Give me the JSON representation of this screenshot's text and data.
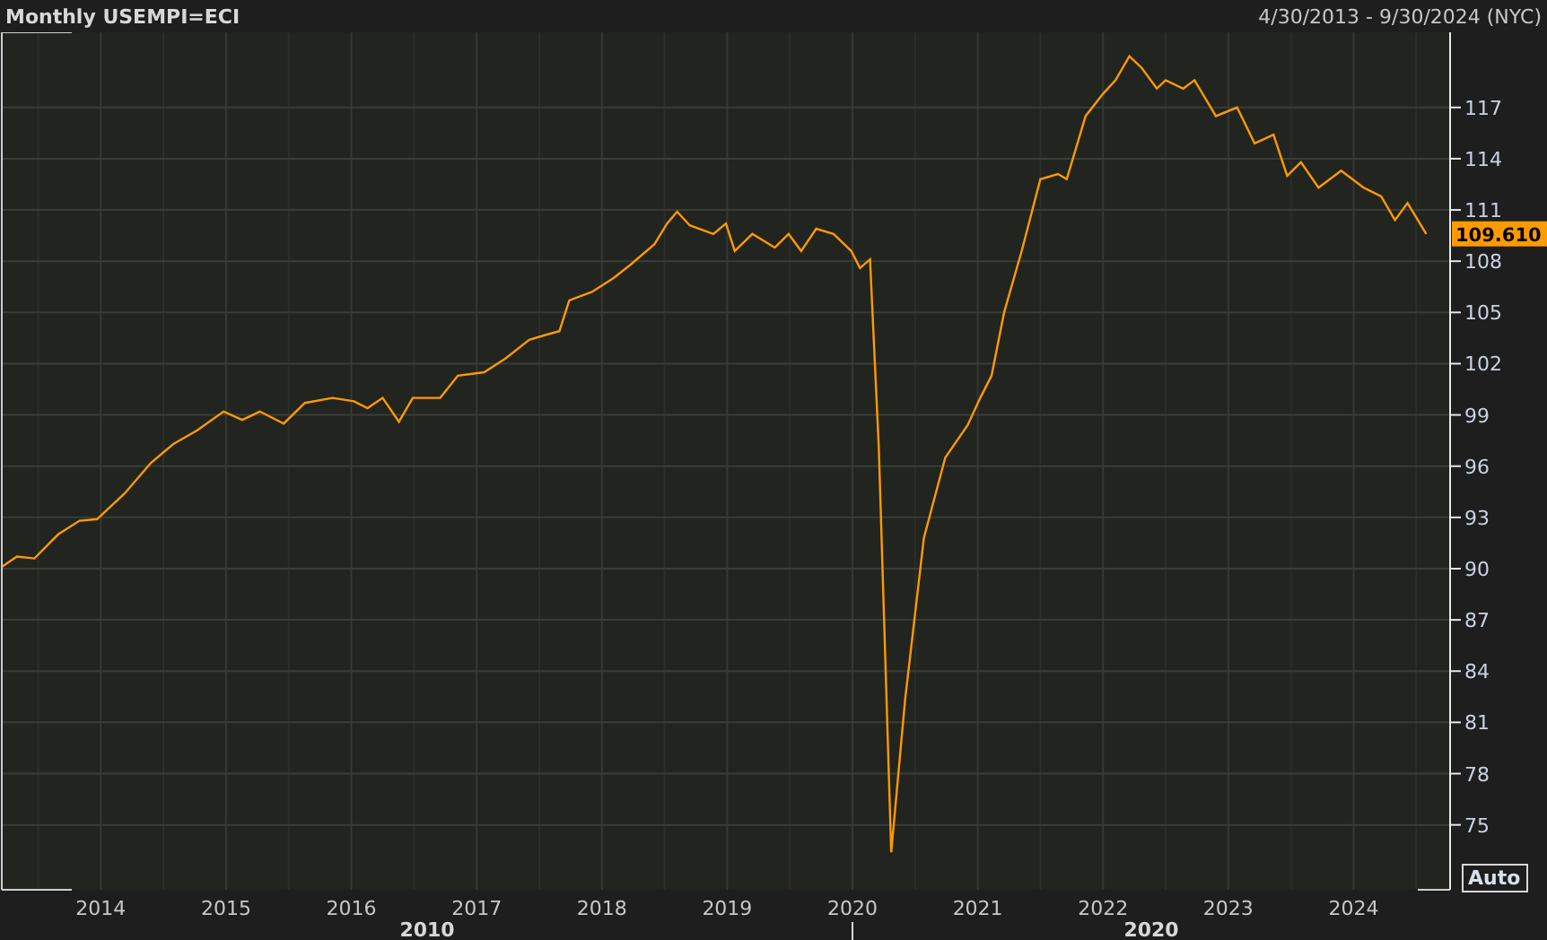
{
  "header": {
    "title": "Monthly USEMPI=ECI",
    "range": "4/30/2013 - 9/30/2024 (NYC)"
  },
  "chart": {
    "last_value": "109.610",
    "auto_button": "Auto",
    "decades": [
      {
        "label": "2010"
      },
      {
        "label": "2020"
      }
    ],
    "chart_data": {
      "type": "line",
      "grid": true,
      "xlim": [
        2013.21,
        2024.77
      ],
      "ylim": [
        71.2,
        121.4
      ],
      "yticks": [
        75,
        78,
        81,
        84,
        87,
        90,
        93,
        96,
        99,
        102,
        105,
        108,
        111,
        114,
        117
      ],
      "xticks": [
        {
          "value": 2014,
          "label": "2014"
        },
        {
          "value": 2015,
          "label": "2015"
        },
        {
          "value": 2016,
          "label": "2016"
        },
        {
          "value": 2017,
          "label": "2017"
        },
        {
          "value": 2018,
          "label": "2018"
        },
        {
          "value": 2019,
          "label": "2019"
        },
        {
          "value": 2020,
          "label": "2020"
        },
        {
          "value": 2021,
          "label": "2021"
        },
        {
          "value": 2022,
          "label": "2022"
        },
        {
          "value": 2023,
          "label": "2023"
        },
        {
          "value": 2024,
          "label": "2024"
        }
      ],
      "x": [
        2013.21,
        2013.33,
        2013.47,
        2013.66,
        2013.83,
        2013.97,
        2014.19,
        2014.4,
        2014.58,
        2014.77,
        2014.98,
        2015.13,
        2015.27,
        2015.46,
        2015.63,
        2015.85,
        2016.02,
        2016.13,
        2016.25,
        2016.38,
        2016.49,
        2016.71,
        2016.85,
        2017.06,
        2017.23,
        2017.42,
        2017.56,
        2017.66,
        2017.74,
        2017.92,
        2018.09,
        2018.23,
        2018.42,
        2018.52,
        2018.6,
        2018.7,
        2018.89,
        2018.99,
        2019.06,
        2019.2,
        2019.38,
        2019.49,
        2019.59,
        2019.71,
        2019.85,
        2019.99,
        2020.06,
        2020.14,
        2020.21,
        2020.31,
        2020.42,
        2020.57,
        2020.74,
        2020.92,
        2021.02,
        2021.11,
        2021.21,
        2021.35,
        2021.5,
        2021.64,
        2021.71,
        2021.86,
        2022.0,
        2022.1,
        2022.21,
        2022.31,
        2022.43,
        2022.5,
        2022.64,
        2022.73,
        2022.9,
        2023.07,
        2023.21,
        2023.36,
        2023.47,
        2023.58,
        2023.72,
        2023.9,
        2024.08,
        2024.22,
        2024.33,
        2024.43,
        2024.58
      ],
      "series": [
        {
          "color": "#ff9a00",
          "values": [
            90.1,
            90.7,
            90.6,
            92.0,
            92.8,
            92.9,
            94.4,
            96.2,
            97.3,
            98.1,
            99.2,
            98.7,
            99.2,
            98.5,
            99.7,
            100.0,
            99.8,
            99.4,
            100.0,
            98.6,
            100.0,
            100.0,
            101.3,
            101.5,
            102.3,
            103.4,
            103.7,
            103.9,
            105.7,
            106.2,
            107.0,
            107.8,
            109.0,
            110.2,
            110.9,
            110.1,
            109.6,
            110.2,
            108.6,
            109.6,
            108.8,
            109.6,
            108.6,
            109.9,
            109.6,
            108.6,
            107.6,
            108.1,
            97.0,
            73.4,
            82.3,
            91.8,
            96.5,
            98.4,
            100.0,
            101.3,
            105.0,
            108.6,
            112.8,
            113.1,
            112.8,
            116.5,
            117.8,
            118.6,
            120.0,
            119.3,
            118.1,
            118.6,
            118.1,
            118.6,
            116.5,
            117.0,
            114.9,
            115.4,
            113.0,
            113.8,
            112.3,
            113.3,
            112.3,
            111.8,
            110.4,
            111.4,
            109.6
          ]
        }
      ]
    }
  }
}
